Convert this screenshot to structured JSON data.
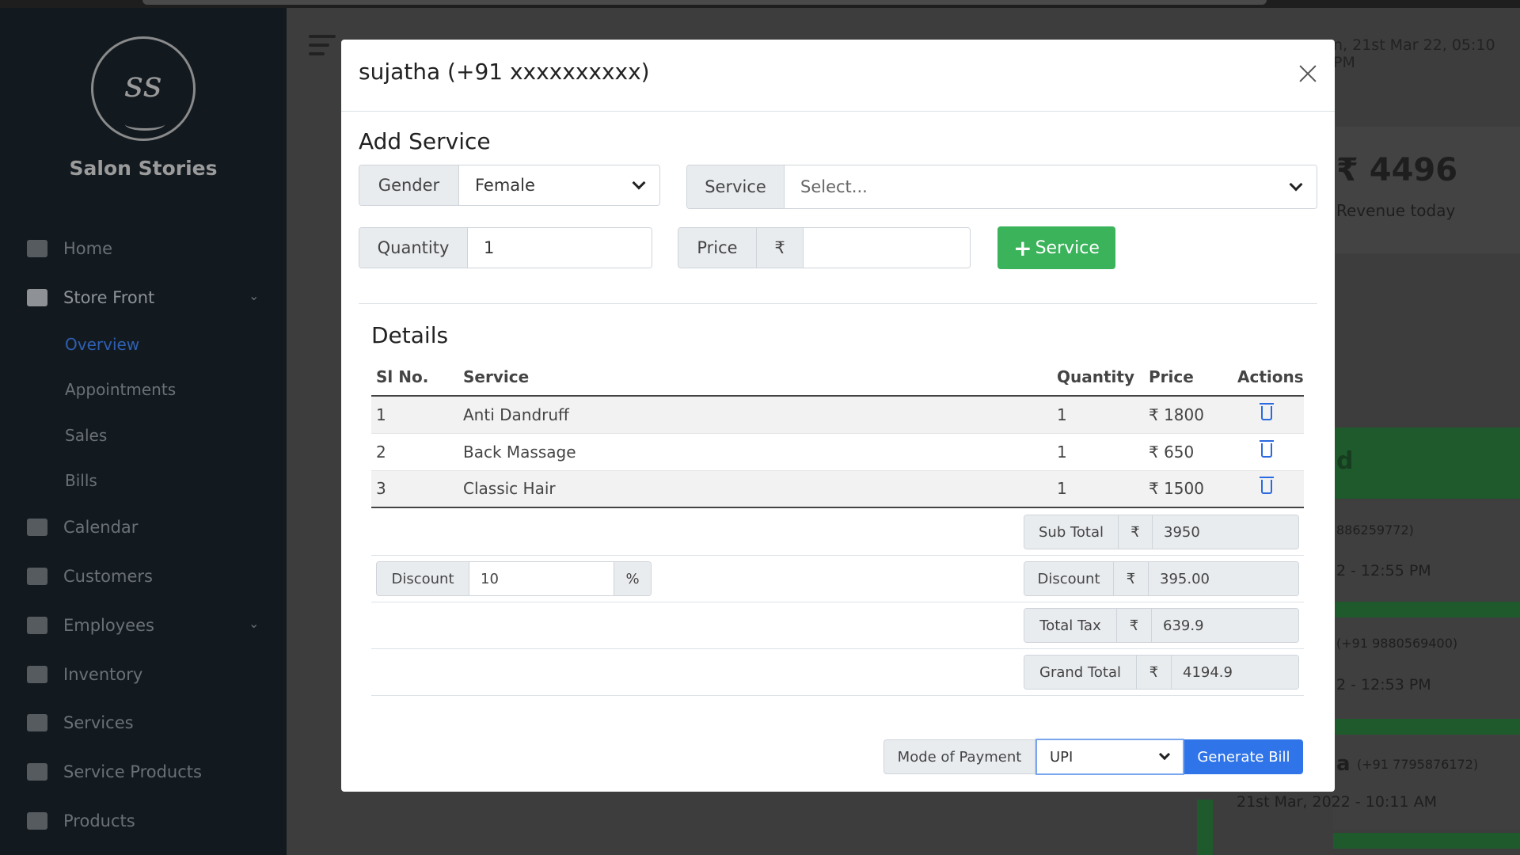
{
  "app": {
    "brand": "Salon Stories"
  },
  "sidebar": {
    "items": [
      {
        "label": "Home",
        "icon": "home-icon"
      },
      {
        "label": "Store Front",
        "icon": "store-icon",
        "expanded": true
      },
      {
        "label": "Calendar",
        "icon": "calendar-icon"
      },
      {
        "label": "Customers",
        "icon": "customers-icon"
      },
      {
        "label": "Employees",
        "icon": "employees-icon"
      },
      {
        "label": "Inventory",
        "icon": "inventory-icon"
      },
      {
        "label": "Services",
        "icon": "services-icon"
      },
      {
        "label": "Service Products",
        "icon": "service-products-icon"
      },
      {
        "label": "Products",
        "icon": "products-icon"
      }
    ],
    "store_front_sub": [
      "Overview",
      "Appointments",
      "Sales",
      "Bills"
    ],
    "active_sub": "Overview"
  },
  "background": {
    "date_text": "n, 21st Mar 22, 05:10 PM",
    "revenue": "₹ 4496",
    "revenue_label": "Revenue today",
    "green_letter": "d",
    "card1_phone": "886259772)",
    "card1_time": "2 - 12:55 PM",
    "card2_phone": "(+91 9880569400)",
    "card2_time": "2 - 12:53 PM",
    "card3_name": "a",
    "card3_phone": "(+91 7795876172)",
    "card3_time": "21st Mar, 2022 - 10:11 AM"
  },
  "modal": {
    "title": "sujatha (+91 xxxxxxxxxx)",
    "add_service_title": "Add Service",
    "gender": {
      "label": "Gender",
      "value": "Female"
    },
    "service": {
      "label": "Service",
      "placeholder": "Select..."
    },
    "quantity": {
      "label": "Quantity",
      "value": "1"
    },
    "price": {
      "label": "Price",
      "currency": "₹",
      "value": ""
    },
    "add_button": "Service",
    "details_title": "Details",
    "table": {
      "headers": [
        "Sl No.",
        "Service",
        "Quantity",
        "Price",
        "Actions"
      ],
      "rows": [
        {
          "sl": "1",
          "service": "Anti Dandruff",
          "qty": "1",
          "price": "₹ 1800"
        },
        {
          "sl": "2",
          "service": "Back Massage",
          "qty": "1",
          "price": "₹ 650"
        },
        {
          "sl": "3",
          "service": "Classic Hair",
          "qty": "1",
          "price": "₹ 1500"
        }
      ]
    },
    "totals": {
      "subtotal": {
        "label": "Sub Total",
        "currency": "₹",
        "value": "3950"
      },
      "discount_pct": {
        "label": "Discount",
        "value": "10",
        "suffix": "%"
      },
      "discount": {
        "label": "Discount",
        "currency": "₹",
        "value": "395.00"
      },
      "tax": {
        "label": "Total Tax",
        "currency": "₹",
        "value": "639.9"
      },
      "grand": {
        "label": "Grand Total",
        "currency": "₹",
        "value": "4194.9"
      }
    },
    "payment": {
      "label": "Mode of Payment",
      "value": "UPI"
    },
    "generate_button": "Generate Bill"
  },
  "colors": {
    "primary": "#2f74e8",
    "success": "#3bb35a",
    "sidebar_bg": "#121a20"
  }
}
